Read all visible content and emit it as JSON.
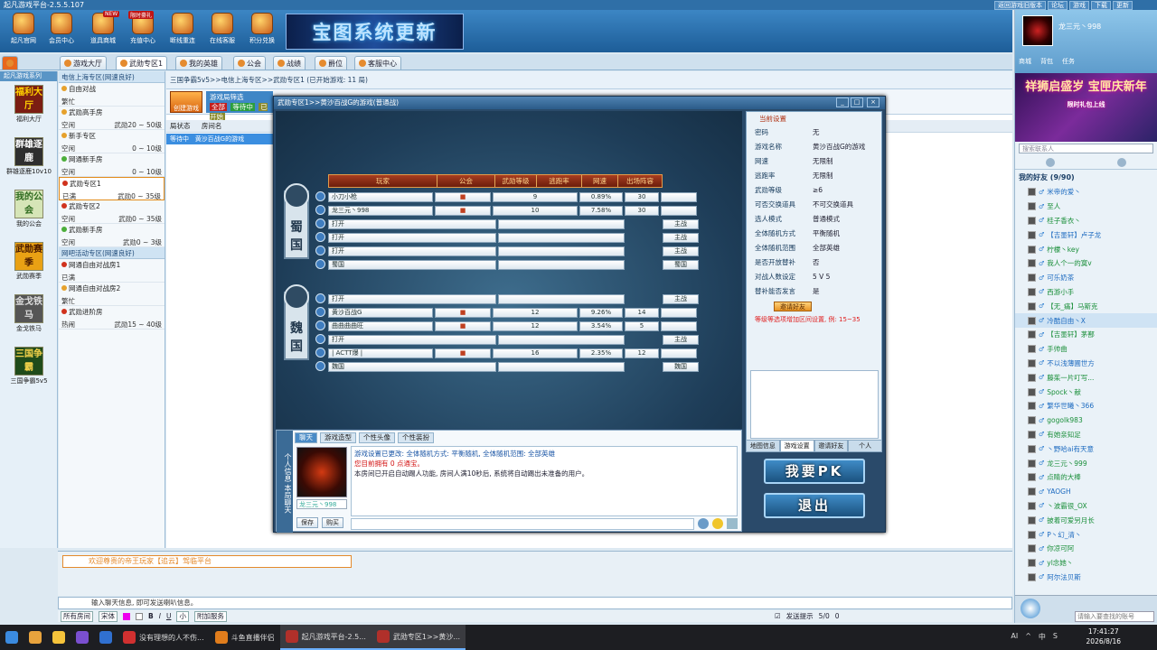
{
  "window": {
    "title": "起凡游戏平台-2.5.5.107",
    "controls": [
      "返回游戏旧版本",
      "论坛",
      "游戏",
      "下载",
      "更新"
    ]
  },
  "topbar": {
    "buttons": [
      {
        "label": "起凡官网"
      },
      {
        "label": "会员中心"
      },
      {
        "label": "道具商城",
        "badge": "NEW"
      },
      {
        "label": "充值中心",
        "badge": "限时豪礼"
      },
      {
        "label": "断线重连"
      },
      {
        "label": "在线客服"
      },
      {
        "label": "积分兑换"
      }
    ],
    "banner": "宝图系统更新"
  },
  "tabs": [
    "游戏大厅",
    "武勋专区1",
    "我的英雄",
    "公会",
    "战绩",
    "爵位",
    "客服中心"
  ],
  "leftcol": {
    "header": "起凡游戏系列",
    "items": [
      {
        "label": "福利大厅",
        "icon_text": "福利大厅"
      },
      {
        "label": "群雄逐鹿10v10",
        "icon_text": "群雄逐鹿"
      },
      {
        "label": "我的公会",
        "icon_text": "我的公会"
      },
      {
        "label": "武勋赛季",
        "icon_text": "武勋赛季"
      },
      {
        "label": "金戈铁马",
        "icon_text": "金戈铁马"
      },
      {
        "label": "三国争霸5v5",
        "icon_text": "三国争霸"
      }
    ]
  },
  "zones": {
    "header1": "电信上海专区(网速良好)",
    "header2": "网吧活动专区(网速良好)",
    "list1": [
      {
        "name": "自由对战",
        "status": "繁忙",
        "range": "",
        "dot": "orange"
      },
      {
        "name": "武勋高手房",
        "status": "空闲",
        "range": "武勋20 ~ 50级",
        "dot": "orange"
      },
      {
        "name": "新手专区",
        "status": "空闲",
        "range": "0 ~ 10级",
        "dot": "orange"
      },
      {
        "name": "网通新手房",
        "status": "空闲",
        "range": "0 ~ 10级",
        "dot": "green"
      },
      {
        "name": "武勋专区1",
        "status": "已满",
        "range": "武勋0 ~ 35级",
        "dot": "red"
      },
      {
        "name": "武勋专区2",
        "status": "空闲",
        "range": "武勋0 ~ 35级",
        "dot": "red"
      },
      {
        "name": "武勋新手房",
        "status": "空闲",
        "range": "武勋0 ~ 3级",
        "dot": "green"
      }
    ],
    "list2": [
      {
        "name": "网通自由对战房1",
        "status": "已满",
        "range": "",
        "dot": "red"
      },
      {
        "name": "网通自由对战房2",
        "status": "繁忙",
        "range": "",
        "dot": "orange"
      },
      {
        "name": "武勋进阶房",
        "status": "热闹",
        "range": "武勋15 ~ 40级",
        "dot": "red"
      }
    ]
  },
  "main": {
    "breadcrumb": "三国争霸5v5>>电信上海专区>>武勋专区1 (已开始游戏: 11 局)",
    "toolbar": {
      "create": "创建游戏",
      "game_label": "游戏局筛选",
      "all": "全部",
      "waiting": "等待中",
      "started": "已开始"
    },
    "room_header": [
      "局状态",
      "房间名"
    ],
    "room_row": {
      "status": "等待中",
      "name": "黄沙百战G的游戏"
    }
  },
  "gamewin": {
    "title": "武勋专区1>>黄沙百战G的游戏(普通战)",
    "win_controls": [
      "_",
      "□",
      "×"
    ],
    "table_headers": [
      "玩家",
      "公会",
      "武勋等级",
      "逃跑率",
      "网速",
      "出场阵容"
    ],
    "factions": [
      {
        "name": "蜀国"
      },
      {
        "name": "魏国"
      }
    ],
    "shu_rows": [
      {
        "player": "小刀小枪",
        "level": "9",
        "escape": "0.89%",
        "ping": "30",
        "slot": ""
      },
      {
        "player": "龙三元丶998",
        "level": "10",
        "escape": "7.58%",
        "ping": "30",
        "slot": ""
      },
      {
        "player": "打开",
        "level": "",
        "escape": "",
        "ping": "",
        "slot": "主战"
      },
      {
        "player": "打开",
        "level": "",
        "escape": "",
        "ping": "",
        "slot": "主战"
      },
      {
        "player": "打开",
        "level": "",
        "escape": "",
        "ping": "",
        "slot": "主战"
      },
      {
        "player": "蜀国",
        "level": "",
        "escape": "",
        "ping": "",
        "slot": "蜀国"
      }
    ],
    "wei_rows": [
      {
        "player": "打开",
        "level": "",
        "escape": "",
        "ping": "",
        "slot": "主战"
      },
      {
        "player": "黄沙百战G",
        "level": "12",
        "escape": "9.26%",
        "ping": "14",
        "slot": ""
      },
      {
        "player": "曲曲曲曲旺",
        "level": "12",
        "escape": "3.54%",
        "ping": "5",
        "slot": ""
      },
      {
        "player": "打开",
        "level": "",
        "escape": "",
        "ping": "",
        "slot": "主战"
      },
      {
        "player": "| ACTT爆 |",
        "level": "16",
        "escape": "2.35%",
        "ping": "12",
        "slot": ""
      },
      {
        "player": "魏国",
        "level": "",
        "escape": "",
        "ping": "",
        "slot": "魏国"
      }
    ],
    "settings": {
      "header": "当前设置",
      "rows": [
        {
          "k": "密码",
          "v": "无"
        },
        {
          "k": "游戏名称",
          "v": "黄沙百战G的游戏"
        },
        {
          "k": "网速",
          "v": "无限制"
        },
        {
          "k": "逃跑率",
          "v": "无限制"
        },
        {
          "k": "武勋等级",
          "v": "≥6"
        },
        {
          "k": "可否交换道具",
          "v": "不可交换道具"
        },
        {
          "k": "选人模式",
          "v": "普通模式"
        },
        {
          "k": "全体随机方式",
          "v": "平衡随机"
        },
        {
          "k": "全体随机范围",
          "v": "全部英雄"
        },
        {
          "k": "是否开放替补",
          "v": "否"
        },
        {
          "k": "对战人数设定",
          "v": "5 V 5"
        },
        {
          "k": "替补能否发言",
          "v": "是"
        }
      ],
      "invite": "邀请好友",
      "hint": "等级等选项增加区间设置, 例: 15~35",
      "tabs": [
        "地图信息",
        "游戏设置",
        "邀请好友",
        "个人"
      ]
    },
    "buttons": {
      "pk": "我要PK",
      "exit": "退出"
    },
    "chat": {
      "side_label": "个人信息 本局聊天",
      "tabs": [
        "聊天",
        "游戏造型",
        "个性头像",
        "个性装扮"
      ],
      "avatar_name": "龙三元丶998",
      "save": "保存",
      "buy": "购买",
      "lines": [
        {
          "text": "游戏设置已更改: 全体随机方式: 平衡随机, 全体随机范围: 全部英雄",
          "cls": "blue"
        },
        {
          "text": "您目前拥有 0 点通宝。",
          "cls": "red"
        },
        {
          "text": "本房间已开启自动踢人功能, 房间人满10秒后, 系统将自动踢出未准备的用户。",
          "cls": ""
        }
      ]
    }
  },
  "bottom": {
    "marquee": "欢迎尊贵的帝王玩家【追云】驾临平台",
    "input_placeholder": "输入聊天信息, 即可发送喇叭信息。",
    "tools": {
      "scope": "所有房间",
      "font": "宋体",
      "size": "小",
      "extra": "附加服务",
      "tip": "发送提示",
      "score": "5/0",
      "count": "0"
    }
  },
  "rightpanel": {
    "username": "龙三元丶998",
    "links": [
      "商城",
      "背包",
      "任务"
    ],
    "ad_title": "祥狮启盛岁 宝匣庆新年",
    "ad_sub": "限时礼包上线",
    "search_placeholder": "搜索联系人",
    "list_header": "我的好友 (9/90)",
    "friends": [
      "米帝的爱丶",
      "至人",
      "桂子香衣丶",
      "【吉墨轩】卢子龙",
      "柠檬丶key",
      "我人个一的寞v",
      "可乐奶茶",
      "西游小手",
      "【无_痛】马斯克",
      "冷酷自由丶X",
      "【吉墨轩】茅鄯",
      "手帅曲",
      "不以浅薄圃世方",
      "藤茱一片叮写...",
      "Spock丶献",
      "繁华世曦丶366",
      "gogolk983",
      "有她亲知足",
      "丶野哈ai有天意",
      "龙三元丶999",
      "点睛的大棒",
      "YAOGH",
      "丶波霸很_OX",
      "披着可爱另月长",
      "P丶幻_清丶",
      "你凉可阿",
      "yl念她丶",
      "阿尔法贝斯"
    ],
    "bottom_input": "请输入要查找的账号"
  },
  "taskbar": {
    "items": [
      {
        "label": "没有理想的人不伤..."
      },
      {
        "label": "斗鱼直播伴侣"
      },
      {
        "label": "起凡游戏平台-2.5..."
      },
      {
        "label": "武勋专区1>>黄沙..."
      }
    ],
    "time": "17:41:27",
    "date": "2026/8/16",
    "tray": [
      "AI",
      "^",
      "中",
      "S"
    ]
  }
}
